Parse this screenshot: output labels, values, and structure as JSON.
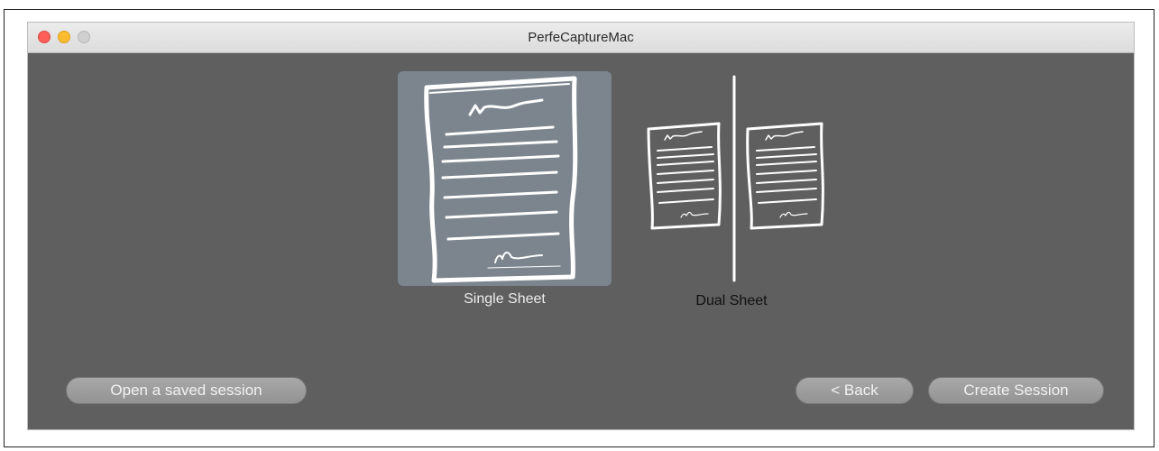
{
  "window": {
    "title": "PerfeCaptureMac"
  },
  "options": {
    "single": {
      "label": "Single Sheet",
      "selected": true,
      "icon": "single-sheet-document-icon"
    },
    "dual": {
      "label": "Dual Sheet",
      "selected": false,
      "icon": "dual-sheet-document-icon"
    }
  },
  "buttons": {
    "open_saved": "Open a saved session",
    "back": "< Back",
    "create": "Create Session"
  },
  "colors": {
    "window_bg": "#5f5f5f",
    "selected_bg": "#7c858e",
    "close": "#fc5f57",
    "minimize": "#fdbc2e",
    "zoom": "#d0d0d0"
  }
}
